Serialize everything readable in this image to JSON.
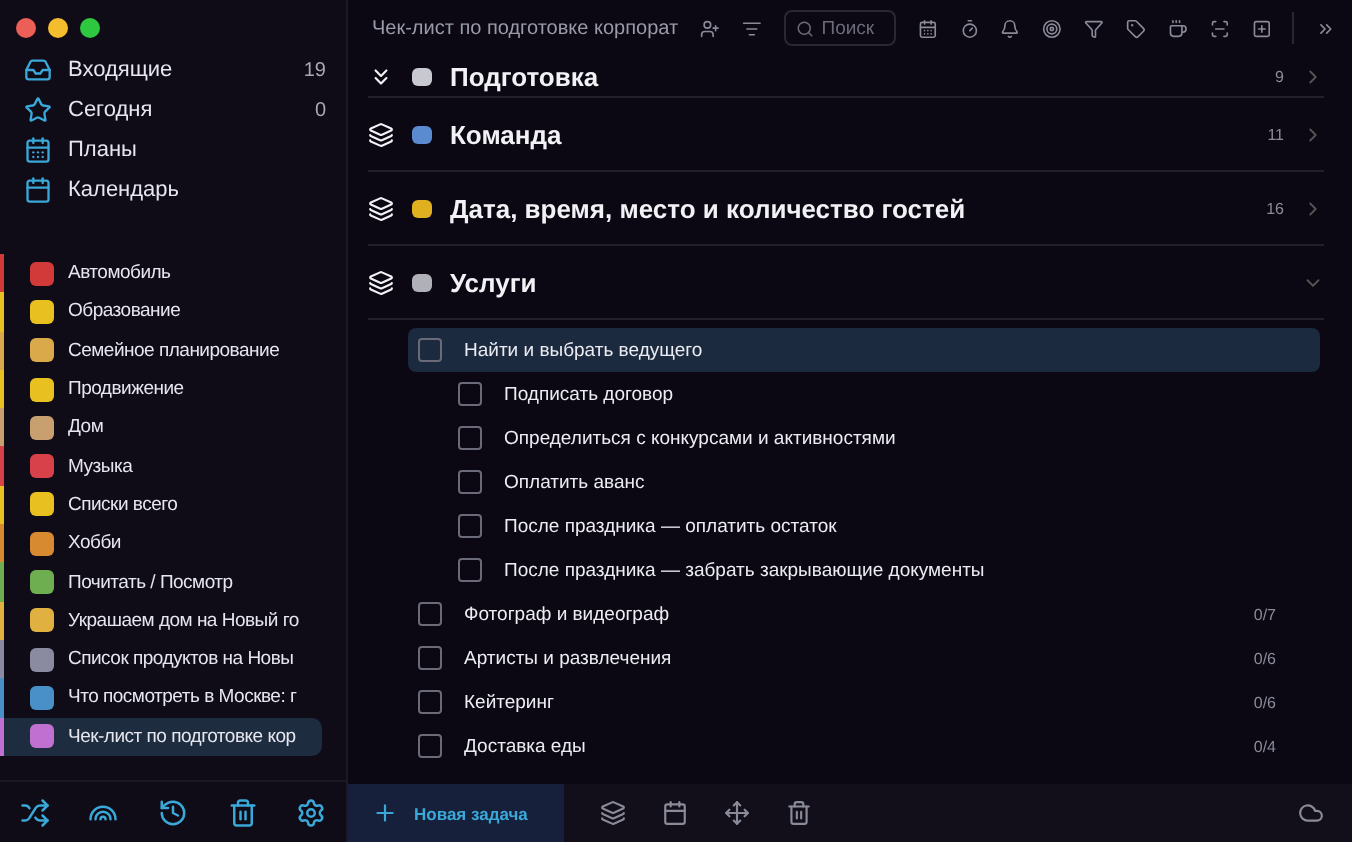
{
  "sidebar": {
    "nav": [
      {
        "kind": "inbox",
        "label": "Входящие",
        "count": "19"
      },
      {
        "kind": "today",
        "label": "Сегодня",
        "count": "0"
      },
      {
        "kind": "plans",
        "label": "Планы"
      },
      {
        "kind": "calendar",
        "label": "Календарь"
      }
    ],
    "lists": [
      {
        "label": "Автомобиль",
        "color": "#d23a3a",
        "selected": false
      },
      {
        "label": "Образование",
        "color": "#e8c020",
        "selected": false
      },
      {
        "label": "Семейное планирование",
        "color": "#d9a94a",
        "selected": false
      },
      {
        "label": "Продвижение",
        "color": "#e8c020",
        "selected": false
      },
      {
        "label": "Дом",
        "color": "#c8a070",
        "selected": false
      },
      {
        "label": "Музыка",
        "color": "#d8404a",
        "selected": false
      },
      {
        "label": "Списки всего",
        "color": "#e8c020",
        "selected": false
      },
      {
        "label": "Хобби",
        "color": "#d88a30",
        "selected": false
      },
      {
        "label": "Почитать / Посмотр",
        "color": "#6fae50",
        "selected": false
      },
      {
        "label": "Украшаем дом на Новый го",
        "color": "#e0b040",
        "selected": false
      },
      {
        "label": "Список продуктов на Новы",
        "color": "#8a8aa0",
        "selected": false
      },
      {
        "label": "Что посмотреть в Москве: г",
        "color": "#4a90c8",
        "selected": false
      },
      {
        "label": "Чек-лист по подготовке кор",
        "color": "#c070d0",
        "selected": true
      }
    ]
  },
  "header": {
    "title": "Чек-лист по подготовке корпорат",
    "search": {
      "placeholder": "Поиск"
    }
  },
  "sections": [
    {
      "title": "Подготовка",
      "count": "9",
      "expanded": false,
      "color": "#c8c8d0"
    },
    {
      "title": "Команда",
      "count": "11",
      "expanded": false,
      "color": "#5a8ad0"
    },
    {
      "title": "Дата, время, место и количество гостей",
      "count": "16",
      "expanded": false,
      "color": "#e0b020"
    },
    {
      "title": "Услуги",
      "expanded": true,
      "color": "#b0b0b8"
    }
  ],
  "tasks": [
    {
      "title": "Найти и выбрать ведущего",
      "checked": false,
      "selected": true,
      "children": [
        {
          "title": "Подписать договор",
          "checked": false,
          "selected": false
        },
        {
          "title": "Определиться с конкурсами и активностями",
          "checked": false,
          "selected": false
        },
        {
          "title": "Оплатить аванс",
          "checked": false,
          "selected": false
        },
        {
          "title": "После праздника — оплатить остаток",
          "checked": false,
          "selected": false
        },
        {
          "title": "После праздника — забрать закрывающие документы",
          "checked": false,
          "selected": false
        }
      ]
    },
    {
      "title": "Фотограф и видеограф",
      "progress": "0/7",
      "checked": false,
      "selected": false
    },
    {
      "title": "Артисты и развлечения",
      "progress": "0/6",
      "checked": false,
      "selected": false
    },
    {
      "title": "Кейтеринг",
      "progress": "0/6",
      "checked": false,
      "selected": false
    },
    {
      "title": "Доставка еды",
      "progress": "0/4",
      "checked": false,
      "selected": false
    }
  ],
  "footer": {
    "new_task": "Новая задача"
  }
}
